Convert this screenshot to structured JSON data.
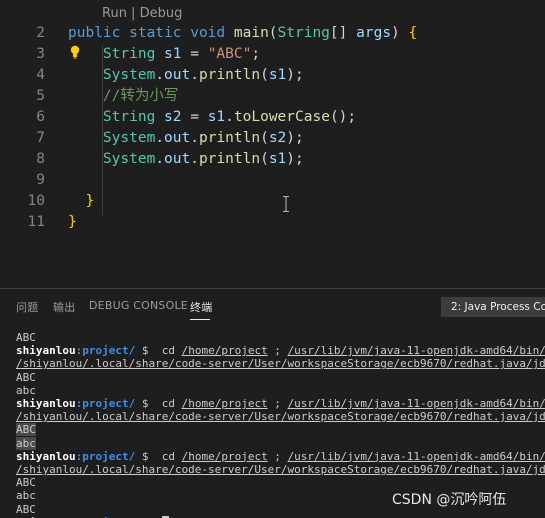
{
  "editor": {
    "codelens": "Run | Debug",
    "lines": [
      {
        "num": "2",
        "tokens": [
          {
            "t": "public ",
            "c": "kw"
          },
          {
            "t": "static ",
            "c": "kw"
          },
          {
            "t": "void ",
            "c": "kw"
          },
          {
            "t": "main",
            "c": "fn"
          },
          {
            "t": "(",
            "c": "pl"
          },
          {
            "t": "String",
            "c": "ty"
          },
          {
            "t": "[] ",
            "c": "pl"
          },
          {
            "t": "args",
            "c": "vr"
          },
          {
            "t": ") ",
            "c": "pl"
          },
          {
            "t": "{",
            "c": "br"
          }
        ]
      },
      {
        "num": "3",
        "tokens": [
          {
            "t": "    String ",
            "c": "ty"
          },
          {
            "t": "s1",
            "c": "vr"
          },
          {
            "t": " = ",
            "c": "pl"
          },
          {
            "t": "\"ABC\"",
            "c": "st"
          },
          {
            "t": ";",
            "c": "pl"
          }
        ]
      },
      {
        "num": "4",
        "tokens": [
          {
            "t": "    System",
            "c": "ty"
          },
          {
            "t": ".",
            "c": "pl"
          },
          {
            "t": "out",
            "c": "vr"
          },
          {
            "t": ".",
            "c": "pl"
          },
          {
            "t": "println",
            "c": "fn"
          },
          {
            "t": "(",
            "c": "pl"
          },
          {
            "t": "s1",
            "c": "vr"
          },
          {
            "t": ");",
            "c": "pl"
          }
        ]
      },
      {
        "num": "5",
        "tokens": [
          {
            "t": "    //转为小写",
            "c": "cm"
          }
        ]
      },
      {
        "num": "6",
        "tokens": [
          {
            "t": "    String ",
            "c": "ty"
          },
          {
            "t": "s2",
            "c": "vr"
          },
          {
            "t": " = ",
            "c": "pl"
          },
          {
            "t": "s1",
            "c": "vr"
          },
          {
            "t": ".",
            "c": "pl"
          },
          {
            "t": "toLowerCase",
            "c": "fn"
          },
          {
            "t": "();",
            "c": "pl"
          }
        ]
      },
      {
        "num": "7",
        "tokens": [
          {
            "t": "    System",
            "c": "ty"
          },
          {
            "t": ".",
            "c": "pl"
          },
          {
            "t": "out",
            "c": "vr"
          },
          {
            "t": ".",
            "c": "pl"
          },
          {
            "t": "println",
            "c": "fn"
          },
          {
            "t": "(",
            "c": "pl"
          },
          {
            "t": "s2",
            "c": "vr"
          },
          {
            "t": ");",
            "c": "pl"
          }
        ]
      },
      {
        "num": "8",
        "tokens": [
          {
            "t": "    System",
            "c": "ty"
          },
          {
            "t": ".",
            "c": "pl"
          },
          {
            "t": "out",
            "c": "vr"
          },
          {
            "t": ".",
            "c": "pl"
          },
          {
            "t": "println",
            "c": "fn"
          },
          {
            "t": "(",
            "c": "pl"
          },
          {
            "t": "s1",
            "c": "vr"
          },
          {
            "t": ");",
            "c": "pl"
          }
        ]
      },
      {
        "num": "9",
        "tokens": []
      },
      {
        "num": "10",
        "tokens": [
          {
            "t": "  ",
            "c": "pl"
          },
          {
            "t": "}",
            "c": "br"
          }
        ]
      },
      {
        "num": "11",
        "tokens": [
          {
            "t": "}",
            "c": "br"
          }
        ]
      }
    ]
  },
  "panel": {
    "tabs": [
      "问题",
      "输出",
      "DEBUG CONSOLE",
      "终端"
    ],
    "active_tab": "终端",
    "terminal_selector": "2: Java Process Con"
  },
  "terminal": {
    "user": "shiyanlou",
    "path": ":project/",
    "prompt_suffix": " $  ",
    "cmd_cd": "cd ",
    "cmd_dir": "/home/project",
    "cmd_sep": " ; ",
    "cmd_java": "/usr/lib/jvm/java-11-openjdk-amd64/bin/java -",
    "cont_line": "/shiyanlou/.local/share/code-server/User/workspaceStorage/ecb9670/redhat.java/jdt_ws/p",
    "lines": [
      {
        "type": "out",
        "text": "ABC"
      },
      {
        "type": "cmd"
      },
      {
        "type": "cont"
      },
      {
        "type": "out",
        "text": "ABC"
      },
      {
        "type": "out",
        "text": "abc"
      },
      {
        "type": "cmd"
      },
      {
        "type": "cont"
      },
      {
        "type": "out",
        "text": "ABC",
        "selected": true
      },
      {
        "type": "out",
        "text": "abc",
        "selected": true
      },
      {
        "type": "cmd"
      },
      {
        "type": "cont"
      },
      {
        "type": "out",
        "text": "ABC"
      },
      {
        "type": "out",
        "text": "abc"
      },
      {
        "type": "out",
        "text": "ABC"
      },
      {
        "type": "prompt"
      }
    ]
  },
  "watermark": "CSDN @沉吟阿伍"
}
